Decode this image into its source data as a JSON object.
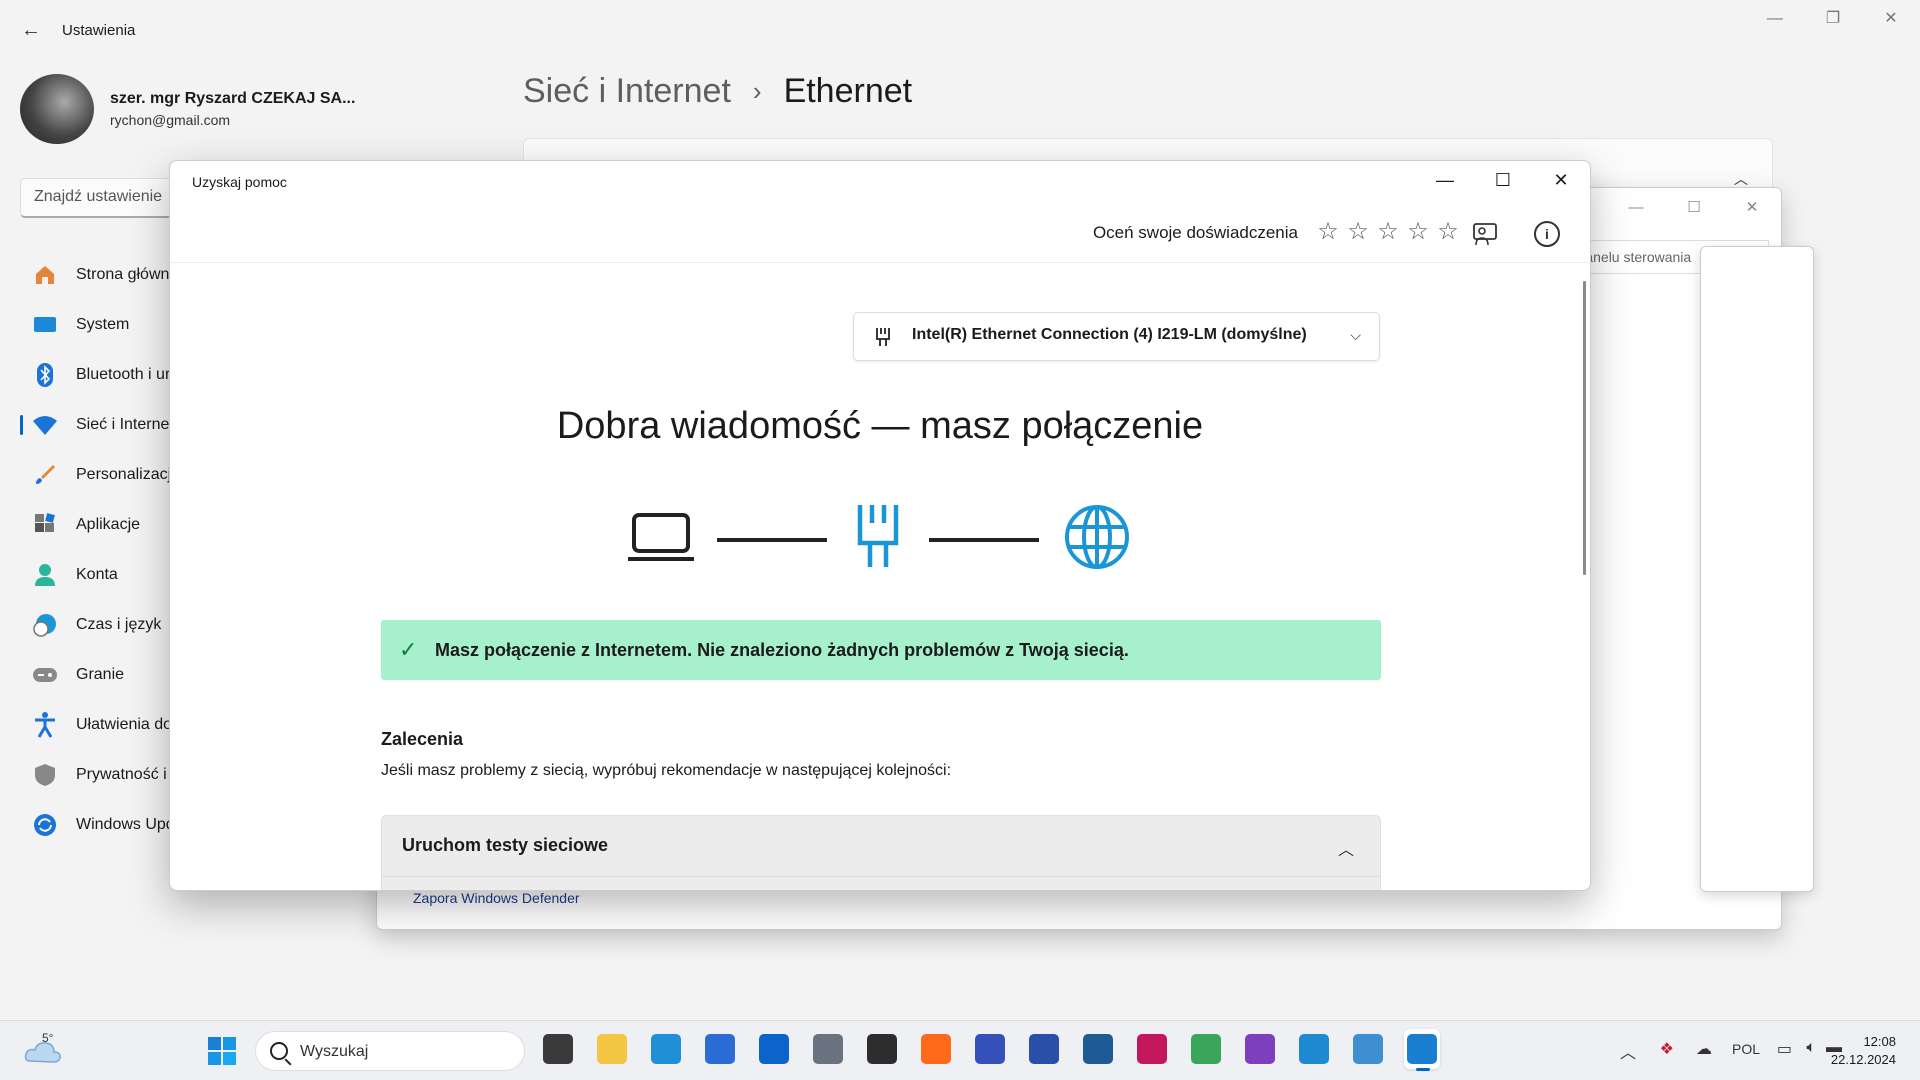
{
  "settings": {
    "title": "Ustawienia",
    "user": {
      "name": "szer. mgr Ryszard CZEKAJ SA...",
      "email": "rychon@gmail.com"
    },
    "search_placeholder": "Znajdź ustawienie",
    "nav": [
      {
        "label": "Strona główna",
        "icon": "home-icon"
      },
      {
        "label": "System",
        "icon": "system-icon"
      },
      {
        "label": "Bluetooth i urządzenia",
        "icon": "bluetooth-icon"
      },
      {
        "label": "Sieć i Internet",
        "icon": "wifi-icon",
        "active": true
      },
      {
        "label": "Personalizacja",
        "icon": "brush-icon"
      },
      {
        "label": "Aplikacje",
        "icon": "apps-icon"
      },
      {
        "label": "Konta",
        "icon": "account-icon"
      },
      {
        "label": "Czas i język",
        "icon": "clock-globe-icon"
      },
      {
        "label": "Granie",
        "icon": "gamepad-icon"
      },
      {
        "label": "Ułatwienia dostępu",
        "icon": "accessibility-icon"
      },
      {
        "label": "Prywatność i zabezpieczenia",
        "icon": "shield-icon"
      },
      {
        "label": "Windows Update",
        "icon": "update-icon"
      }
    ],
    "breadcrumb": {
      "parent": "Sieć i Internet",
      "separator": "›",
      "current": "Ethernet"
    }
  },
  "control_panel": {
    "search_placeholder": "Przeszukaj Panelu sterowania",
    "search_visible": "Panelu sterowania",
    "link": "Zapora Windows Defender"
  },
  "help": {
    "title": "Uzyskaj pomoc",
    "rate_label": "Oceń swoje doświadczenia",
    "rating": 0,
    "rating_max": 5,
    "adapter": "Intel(R) Ethernet Connection (4) I219-LM (domyślne)",
    "headline": "Dobra wiadomość — masz połączenie",
    "status": "Masz połączenie z Internetem. Nie znaleziono żadnych problemów z Twoją siecią.",
    "recommendations_title": "Zalecenia",
    "recommendations_desc": "Jeśli masz problemy z siecią, wypróbuj rekomendacje w następującej kolejności:",
    "accordion_label": "Uruchom testy sieciowe"
  },
  "taskbar": {
    "temperature": "5°",
    "search": "Wyszukaj",
    "language": "POL",
    "time": "12:08",
    "date": "22.12.2024",
    "apps": [
      {
        "name": "task-view-icon",
        "color": "#3a3a3a"
      },
      {
        "name": "file-explorer-icon",
        "color": "#f4c542"
      },
      {
        "name": "edge-icon",
        "color": "#1f8fd8"
      },
      {
        "name": "store-icon",
        "color": "#2b6cd4"
      },
      {
        "name": "outlook-icon",
        "color": "#0a64c9"
      },
      {
        "name": "settings-icon",
        "color": "#6b7280"
      },
      {
        "name": "terminal-icon",
        "color": "#2d2d2d"
      },
      {
        "name": "firefox-icon",
        "color": "#ff6a1a"
      },
      {
        "name": "save-disk-icon",
        "color": "#3550b8"
      },
      {
        "name": "inkscape-icon",
        "color": "#2a4fa8"
      },
      {
        "name": "virtualbox-icon",
        "color": "#1d5a96"
      },
      {
        "name": "resolve-icon",
        "color": "#c2185b"
      },
      {
        "name": "git-icon",
        "color": "#3aa65b"
      },
      {
        "name": "github-icon",
        "color": "#7e3fbf"
      },
      {
        "name": "vscode-icon",
        "color": "#1f8ad2"
      },
      {
        "name": "control-panel-icon",
        "color": "#3d8fd1"
      },
      {
        "name": "get-help-icon",
        "color": "#1b7fd1",
        "active": true
      }
    ]
  },
  "colors": {
    "accent": "#0067c0",
    "success_bg": "#a7f0cc",
    "success_check": "#107c41",
    "network_icon": "#1a96d6"
  }
}
